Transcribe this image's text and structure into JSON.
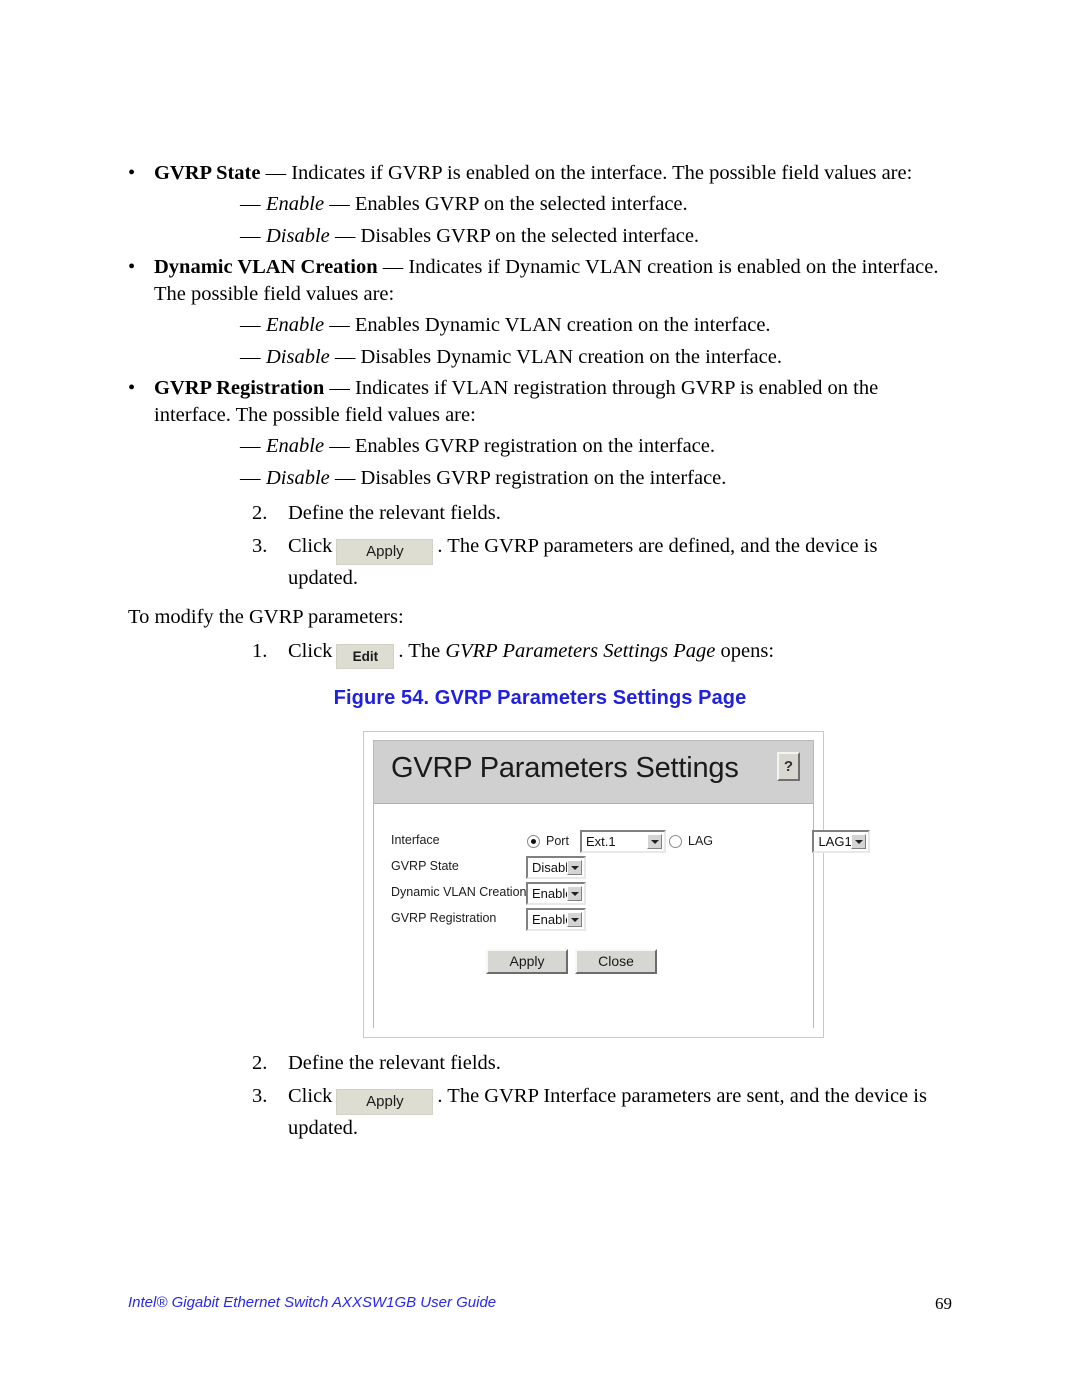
{
  "document": {
    "body": {
      "bullets": [
        {
          "marker": "•",
          "term": "GVRP State",
          "dash": "—",
          "text": " Indicates if GVRP is enabled on the interface. The possible field values are:",
          "subitems": [
            {
              "marker": "—",
              "term": "Enable",
              "dash": "—",
              "text": " Enables GVRP on the selected interface."
            },
            {
              "marker": "—",
              "term": "Disable",
              "dash": "—",
              "text": " Disables GVRP on the selected interface."
            }
          ]
        },
        {
          "marker": "•",
          "term": "Dynamic VLAN Creation",
          "dash": "—",
          "text": " Indicates if Dynamic VLAN creation is enabled on the interface. The possible field values are:",
          "subitems": [
            {
              "marker": "—",
              "term": "Enable",
              "dash": "—",
              "text": " Enables Dynamic VLAN creation on the interface."
            },
            {
              "marker": "—",
              "term": "Disable",
              "dash": "—",
              "text": " Disables Dynamic VLAN creation on the interface."
            }
          ]
        },
        {
          "marker": "•",
          "term": "GVRP Registration",
          "dash": "—",
          "text": " Indicates if VLAN registration through GVRP is enabled on the interface. The possible field values are:",
          "subitems": [
            {
              "marker": "—",
              "term": "Enable",
              "dash": "—",
              "text": " Enables GVRP registration on the interface."
            },
            {
              "marker": "—",
              "term": "Disable",
              "dash": "—",
              "text": " Disables GVRP registration on the interface."
            }
          ]
        }
      ],
      "steps_upper": [
        {
          "num": "2.",
          "text": "Define the relevant fields."
        },
        {
          "num": "3.",
          "pre": "Click",
          "button": "Apply",
          "post": ". The GVRP parameters are defined, and the device is updated."
        }
      ],
      "intro_line": "To modify the GVRP parameters:",
      "steps_modify": [
        {
          "num": "1.",
          "pre": "Click",
          "button": "Edit",
          "post_plain": ". The ",
          "post_italic": "GVRP Parameters Settings Page",
          "post_tail": " opens:"
        }
      ],
      "steps_lower": [
        {
          "num": "2.",
          "text": "Define the relevant fields."
        },
        {
          "num": "3.",
          "pre": "Click",
          "button": "Apply",
          "post": ". The GVRP Interface parameters are sent, and the device is updated."
        }
      ]
    },
    "figure": {
      "caption": "Figure 54. GVRP Parameters Settings Page",
      "caption_color": "#2020e0"
    },
    "footer": {
      "left": "Intel® Gigabit Ethernet Switch AXXSW1GB User Guide",
      "page_number": "69",
      "left_color": "#2828e8"
    }
  },
  "dialog": {
    "title": "GVRP Parameters Settings",
    "help_glyph": "?",
    "header_bg": "#d0d0d0",
    "fields": [
      {
        "label": "Interface",
        "type": "interface",
        "port_radio_label": "Port",
        "port_radio_selected": true,
        "port_value": "Ext.1",
        "lag_radio_label": "LAG",
        "lag_radio_selected": false,
        "lag_value": "LAG1"
      },
      {
        "label": "GVRP State",
        "type": "select",
        "value": "Disable"
      },
      {
        "label": "Dynamic VLAN Creation",
        "type": "select",
        "value": "Enable"
      },
      {
        "label": "GVRP Registration",
        "type": "select",
        "value": "Enable"
      }
    ],
    "buttons": [
      {
        "label": "Apply"
      },
      {
        "label": "Close"
      }
    ]
  }
}
